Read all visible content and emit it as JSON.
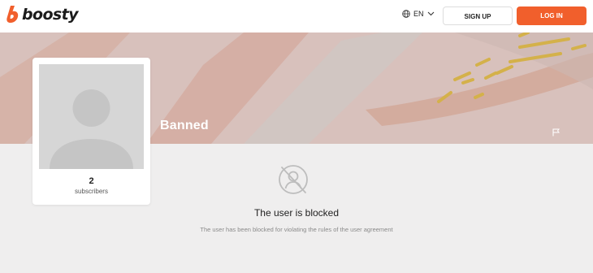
{
  "header": {
    "logo_text": "boosty",
    "language": "EN",
    "signup_label": "SIGN UP",
    "login_label": "LOG IN"
  },
  "profile": {
    "name": "Banned",
    "subscribers_count": "2",
    "subscribers_label": "subscribers"
  },
  "blocked": {
    "title": "The user is blocked",
    "description": "The user has been blocked for violating the rules of the user agreement"
  },
  "colors": {
    "accent": "#f15f2c",
    "cover_bg": "#d9c3bf",
    "page_bg": "#efeeee"
  },
  "icons": [
    "boosty-logo-icon",
    "globe-icon",
    "chevron-down-icon",
    "flag-icon",
    "user-blocked-icon"
  ]
}
